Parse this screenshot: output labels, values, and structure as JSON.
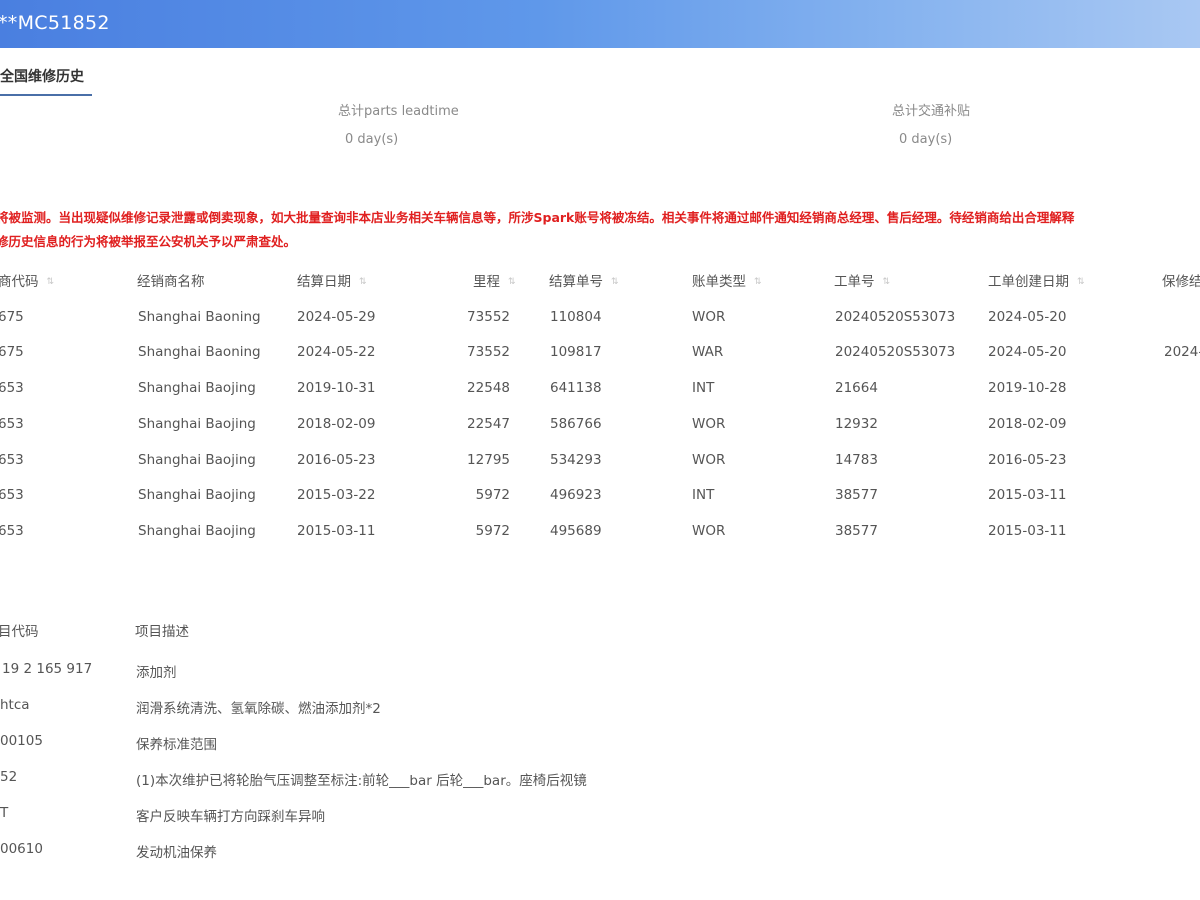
{
  "header": {
    "title": "**MC51852"
  },
  "tab": {
    "label": "全国维修历史"
  },
  "stats": [
    {
      "label": "总计parts leadtime",
      "value": "0 day(s)"
    },
    {
      "label": "总计交通补贴",
      "value": "0 day(s)"
    }
  ],
  "warning": {
    "line1": "将被监测。当出现疑似维修记录泄露或倒卖现象，如大批量查询非本店业务相关车辆信息等，所涉Spark账号将被冻结。相关事件将通过邮件通知经销商总经理、售后经理。待经销商给出合理解释",
    "line2": "修历史信息的行为将被举报至公安机关予以严肃查处。"
  },
  "history_table": {
    "columns": [
      "商代码",
      "经销商名称",
      "结算日期",
      "里程",
      "结算单号",
      "账单类型",
      "工单号",
      "工单创建日期",
      "保修结"
    ],
    "rows": [
      [
        "675",
        "Shanghai Baoning",
        "2024-05-29",
        "73552",
        "110804",
        "WOR",
        "20240520S53073",
        "2024-05-20",
        ""
      ],
      [
        "675",
        "Shanghai Baoning",
        "2024-05-22",
        "73552",
        "109817",
        "WAR",
        "20240520S53073",
        "2024-05-20",
        "2024-"
      ],
      [
        "653",
        "Shanghai Baojing",
        "2019-10-31",
        "22548",
        "641138",
        "INT",
        "21664",
        "2019-10-28",
        ""
      ],
      [
        "653",
        "Shanghai Baojing",
        "2018-02-09",
        "22547",
        "586766",
        "WOR",
        "12932",
        "2018-02-09",
        ""
      ],
      [
        "653",
        "Shanghai Baojing",
        "2016-05-23",
        "12795",
        "534293",
        "WOR",
        "14783",
        "2016-05-23",
        ""
      ],
      [
        "653",
        "Shanghai Baojing",
        "2015-03-22",
        "5972",
        "496923",
        "INT",
        "38577",
        "2015-03-11",
        ""
      ],
      [
        "653",
        "Shanghai Baojing",
        "2015-03-11",
        "5972",
        "495689",
        "WOR",
        "38577",
        "2015-03-11",
        ""
      ]
    ]
  },
  "items_table": {
    "columns": [
      "目代码",
      "项目描述"
    ],
    "rows": [
      [
        "19 2 165 917",
        "添加剂"
      ],
      [
        "htca",
        "润滑系统清洗、氢氧除碳、燃油添加剂*2"
      ],
      [
        "00105",
        "保养标准范围"
      ],
      [
        "52",
        "(1)本次维护已将轮胎气压调整至标注:前轮___bar 后轮___bar。座椅后视镜"
      ],
      [
        "T",
        "客户反映车辆打方向踩刹车异响"
      ],
      [
        "00610",
        "发动机油保养"
      ]
    ]
  }
}
